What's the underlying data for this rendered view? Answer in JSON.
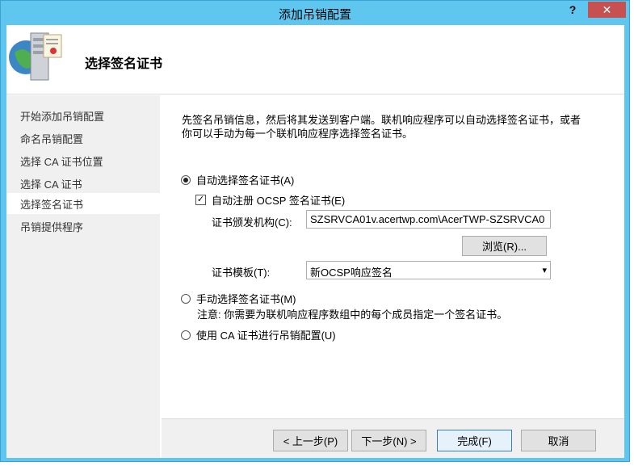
{
  "window": {
    "title": "添加吊销配置",
    "help_glyph": "?",
    "close_glyph": "✕"
  },
  "header": {
    "title": "选择签名证书",
    "icon": "server-certificate-icon"
  },
  "nav": {
    "items": [
      {
        "label": "开始添加吊销配置"
      },
      {
        "label": "命名吊销配置"
      },
      {
        "label": "选择 CA 证书位置"
      },
      {
        "label": "选择 CA 证书"
      },
      {
        "label": "选择签名证书"
      },
      {
        "label": "吊销提供程序"
      }
    ],
    "active_index": 4
  },
  "content": {
    "description_line1": "先签名吊销信息，然后将其发送到客户端。联机响应程序可以自动选择签名证书，或者",
    "description_line2": "你可以手动为每一个联机响应程序选择签名证书。",
    "auto_select_label": "自动选择签名证书(A)",
    "auto_enroll_label": "自动注册 OCSP 签名证书(E)",
    "issuer_label": "证书颁发机构(C):",
    "issuer_value": "SZSRVCA01v.acertwp.com\\AcerTWP-SZSRVCA0",
    "browse_label": "浏览(R)...",
    "template_label": "证书模板(T):",
    "template_value": "新OCSP响应签名",
    "manual_select_label": "手动选择签名证书(M)",
    "manual_note": "注意: 你需要为联机响应程序数组中的每个成员指定一个签名证书。",
    "use_ca_label": "使用 CA 证书进行吊销配置(U)"
  },
  "footer": {
    "prev_label": "< 上一步(P)",
    "next_label": "下一步(N) >",
    "finish_label": "完成(F)",
    "cancel_label": "取消"
  }
}
